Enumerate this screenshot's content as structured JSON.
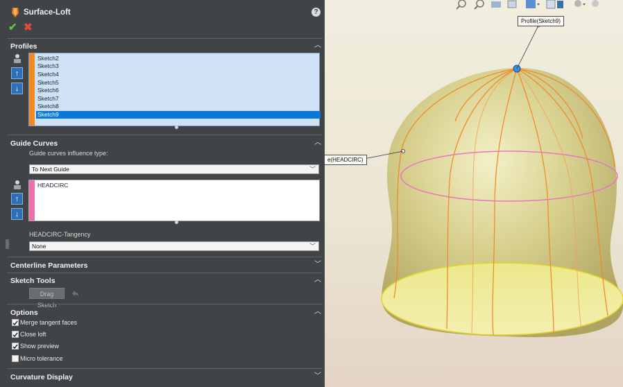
{
  "title": "Surface-Loft",
  "profiles": {
    "header": "Profiles",
    "items": [
      "Sketch2",
      "Sketch3",
      "Sketch4",
      "Sketch5",
      "Sketch6",
      "Sketch7",
      "Sketch8",
      "Sketch9"
    ],
    "selected": "Sketch9"
  },
  "guide": {
    "header": "Guide Curves",
    "influence_label": "Guide curves influence type:",
    "influence_value": "To Next Guide",
    "items": [
      "HEADCIRC"
    ],
    "tangency_label": "HEADCIRC-Tangency",
    "tangency_value": "None"
  },
  "centerline": {
    "header": "Centerline Parameters"
  },
  "sketch_tools": {
    "header": "Sketch Tools",
    "drag_label": "Drag Sketch"
  },
  "options": {
    "header": "Options",
    "items": [
      {
        "label": "Merge tangent faces",
        "checked": true
      },
      {
        "label": "Close loft",
        "checked": true
      },
      {
        "label": "Show preview",
        "checked": true
      },
      {
        "label": "Micro tolerance",
        "checked": false
      }
    ]
  },
  "curvature": {
    "header": "Curvature Display"
  },
  "callouts": {
    "profile": "Profile(Sketch9)",
    "guide": "e(HEADCIRC)"
  },
  "colors": {
    "panel": "#414447",
    "accent_blue": "#0a78d7",
    "profile_stripe": "#f08a24",
    "guide_stripe": "#ee6fae"
  }
}
